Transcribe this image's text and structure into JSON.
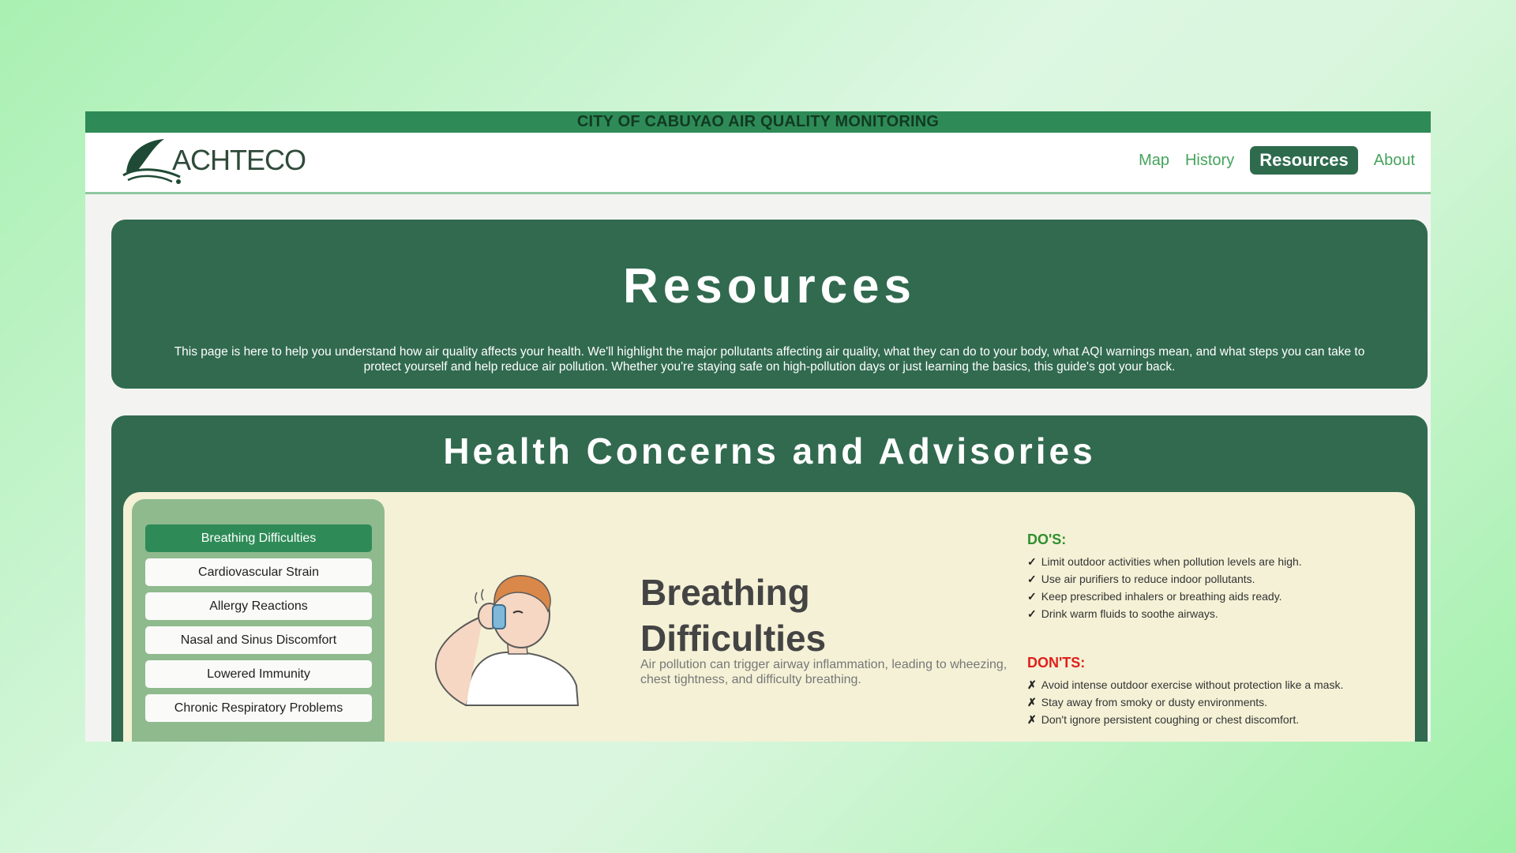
{
  "banner": {
    "title": "CITY OF CABUYAO AIR QUALITY MONITORING"
  },
  "logo": {
    "text": "ACHTECO"
  },
  "nav": {
    "map": "Map",
    "history": "History",
    "resources": "Resources",
    "about": "About",
    "active": "Resources"
  },
  "hero": {
    "title": "Resources",
    "description": "This page is here to help you understand how air quality affects your health. We'll highlight the major pollutants affecting air quality, what they can do to your body, what AQI warnings mean, and what steps you can take to protect yourself and help reduce air pollution. Whether you're staying safe on high-pollution days or just learning the basics, this guide's got your back."
  },
  "health": {
    "title": "Health Concerns and Advisories",
    "topics": [
      "Breathing Difficulties",
      "Cardiovascular Strain",
      "Allergy Reactions",
      "Nasal and Sinus Discomfort",
      "Lowered Immunity",
      "Chronic Respiratory Problems"
    ],
    "selected_topic": "Breathing Difficulties",
    "detail": {
      "title": "Breathing Difficulties",
      "description": "Air pollution can trigger airway inflammation, leading to wheezing, chest tightness, and difficulty breathing."
    },
    "dos": {
      "heading": "DO'S:",
      "mark": "✓",
      "items": [
        "Limit outdoor activities when pollution levels are high.",
        "Use air purifiers to reduce indoor pollutants.",
        "Keep prescribed inhalers or breathing aids ready.",
        "Drink warm fluids to soothe airways."
      ]
    },
    "donts": {
      "heading": "DON'TS:",
      "mark": "✗",
      "items": [
        "Avoid intense outdoor exercise without protection like a mask.",
        "Stay away from smoky or dusty environments.",
        "Don't ignore persistent coughing or chest discomfort."
      ]
    }
  },
  "colors": {
    "banner": "#2e8b57",
    "section": "#316a4f",
    "panel": "#f4f1d6",
    "sidebar": "#8fba8e",
    "selected": "#2e8b57",
    "dos_heading": "#2f8f2f",
    "donts_heading": "#e0201b"
  }
}
